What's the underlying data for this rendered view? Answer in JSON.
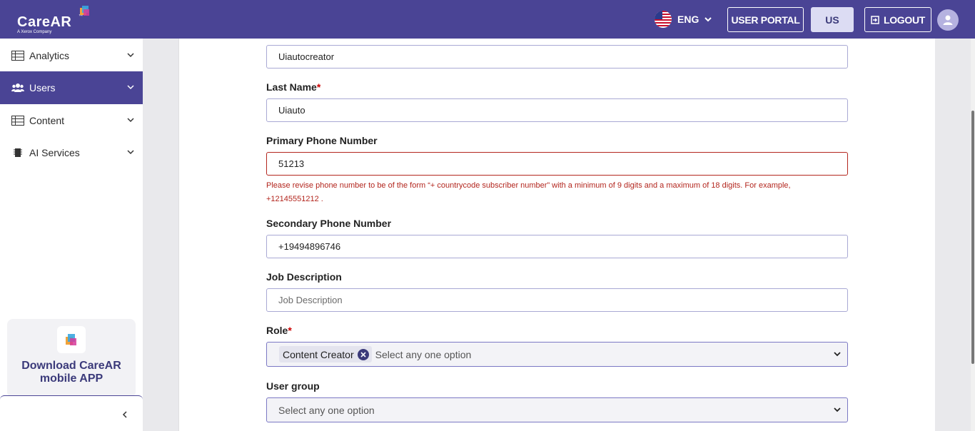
{
  "header": {
    "logo_text": "CareAR",
    "logo_tm": "™",
    "logo_subtitle": "A Xerox Company",
    "language": "ENG",
    "user_portal_label": "USER PORTAL",
    "region_label": "US",
    "logout_label": "LOGOUT",
    "accent_color": "#4a4495"
  },
  "sidebar": {
    "items": [
      {
        "label": "Analytics",
        "icon": "table-icon"
      },
      {
        "label": "Users",
        "icon": "users-icon"
      },
      {
        "label": "Content",
        "icon": "table-icon"
      },
      {
        "label": "AI Services",
        "icon": "chip-icon"
      }
    ],
    "promo_text": "Download CareAR mobile APP"
  },
  "form": {
    "first_name_value": "Uiautocreator",
    "last_name_label": "Last Name",
    "last_name_value": "Uiauto",
    "required_mark": "*",
    "primary_phone_label": "Primary Phone Number",
    "primary_phone_value": "51213",
    "primary_phone_error": "Please revise phone number to be of the form “+ countrycode subscriber number” with a minimum of 9 digits and a maximum of 18 digits. For example, +12145551212 .",
    "secondary_phone_label": "Secondary Phone Number",
    "secondary_phone_value": "+19494896746",
    "job_description_label": "Job Description",
    "job_description_placeholder": "Job Description",
    "role_label": "Role",
    "role_selected": "Content Creator",
    "role_placeholder": "Select any one option",
    "user_group_label": "User group",
    "user_group_placeholder": "Select any one option"
  }
}
